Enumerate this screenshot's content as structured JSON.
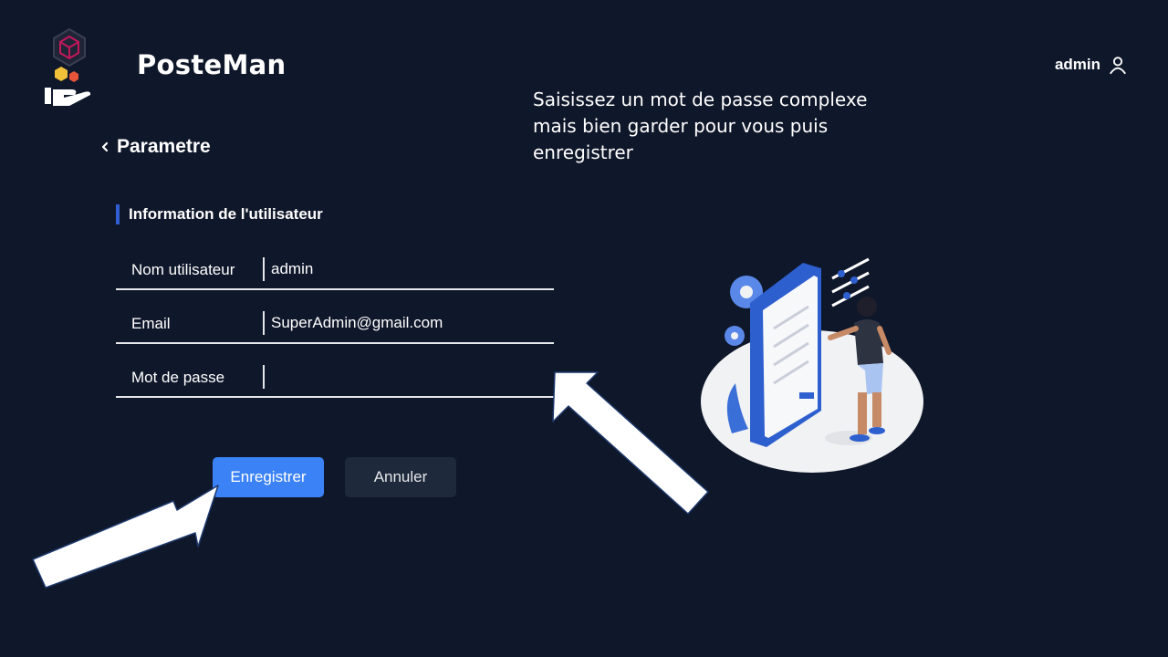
{
  "header": {
    "app_title": "PosteMan",
    "user_label": "admin",
    "logo_icon": "package-hand-logo-icon",
    "user_icon": "user-icon"
  },
  "hint_text": "Saisissez un mot de passe complexe mais bien garder pour vous puis enregistrer",
  "page": {
    "back_label": "Parametre",
    "back_icon": "chevron-left-icon",
    "section_title": "Information de l'utilisateur"
  },
  "form": {
    "username": {
      "label": "Nom utilisateur",
      "value": "admin"
    },
    "email": {
      "label": "Email",
      "value": "SuperAdmin@gmail.com"
    },
    "password": {
      "label": "Mot de passe",
      "value": ""
    }
  },
  "buttons": {
    "save_label": "Enregistrer",
    "cancel_label": "Annuler"
  },
  "colors": {
    "background": "#0f172a",
    "accent": "#2f5fd3",
    "primary_button": "#3b82f6",
    "secondary_button": "#1e293b"
  }
}
